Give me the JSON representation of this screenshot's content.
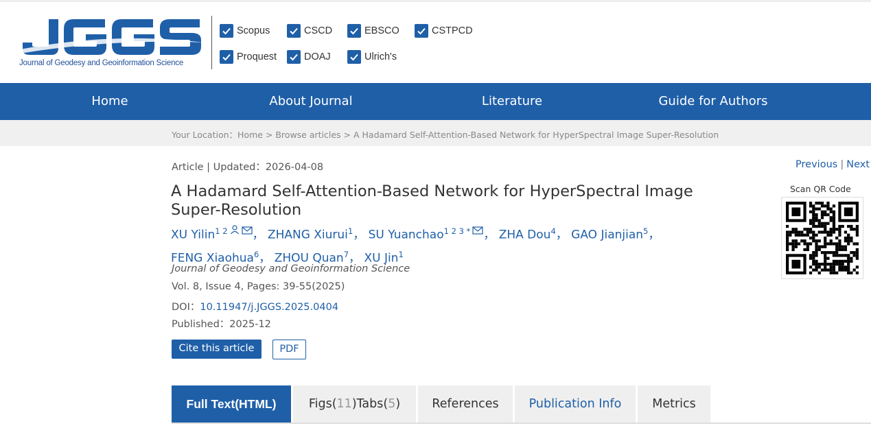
{
  "brand": {
    "logo_text": "JGGS",
    "logo_subtitle": "Journal of Geodesy and Geoinformation Science",
    "primary_color": "#1f5fa8"
  },
  "indexing": [
    {
      "label": "Scopus"
    },
    {
      "label": "CSCD"
    },
    {
      "label": "EBSCO"
    },
    {
      "label": "CSTPCD"
    },
    {
      "label": "Proquest"
    },
    {
      "label": "DOAJ"
    },
    {
      "label": "Ulrich's"
    }
  ],
  "nav": {
    "home": "Home",
    "about": "About Journal",
    "literature": "Literature",
    "guide": "Guide for Authors"
  },
  "breadcrumb": "Your Location：Home > Browse articles > A Hadamard Self-Attention-Based Network for HyperSpectral Image Super-Resolution",
  "article": {
    "type_updated": "Article | Updated：2026-04-08",
    "title": "A Hadamard Self-Attention-Based Network for HyperSpectral Image Super-Resolution",
    "authors": [
      {
        "name": "XU Yilin",
        "sup": "1 2"
      },
      {
        "name": "ZHANG Xiurui",
        "sup": "1"
      },
      {
        "name": "SU Yuanchao",
        "sup": "1 2 3 *"
      },
      {
        "name": "ZHA Dou",
        "sup": "4"
      },
      {
        "name": "GAO Jianjian",
        "sup": "5"
      },
      {
        "name": "FENG Xiaohua",
        "sup": "6"
      },
      {
        "name": "ZHOU Quan",
        "sup": "7"
      },
      {
        "name": "XU Jin",
        "sup": "1"
      }
    ],
    "separator": "，",
    "journal": "Journal of Geodesy and Geoinformation Science",
    "volume": "Vol. 8, Issue 4, Pages: 39-55(2025)",
    "doi_label": "DOI：",
    "doi": "10.11947/j.JGGS.2025.0404",
    "published": "Published：2025-12",
    "cite_label": "Cite this article",
    "pdf_label": "PDF"
  },
  "prev_label": "Previous",
  "next_label": "Next",
  "prevnext_sep": "|",
  "qr_label": "Scan QR Code",
  "tabs": {
    "full_text": "Full Text(HTML)",
    "figs_prefix": "Figs(",
    "figs_count": "11",
    "tabs_mid": ")Tabs(",
    "tabs_count": "5",
    "tabs_suffix": ")",
    "references": "References",
    "publication_info": "Publication Info",
    "metrics": "Metrics"
  }
}
